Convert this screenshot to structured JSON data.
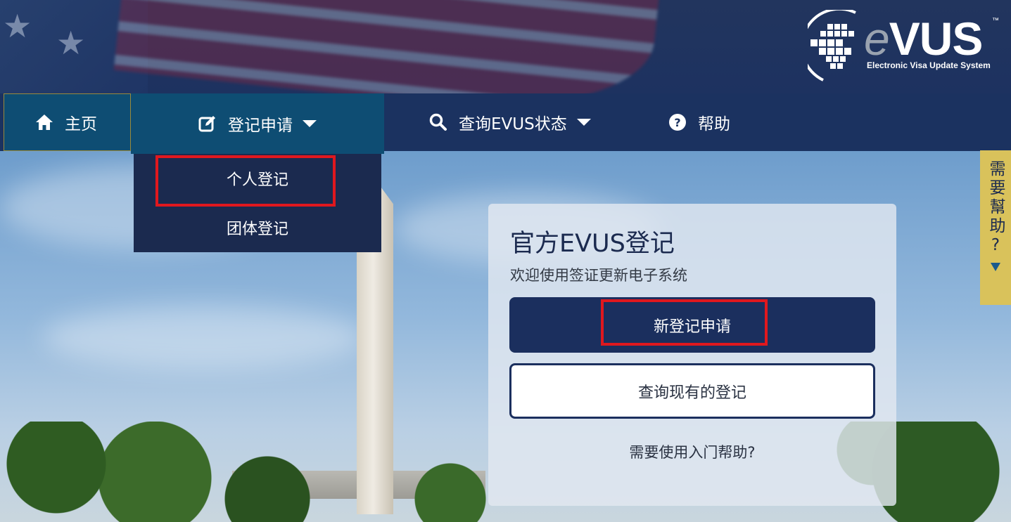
{
  "header": {
    "logo": {
      "word_e": "e",
      "word_vus": "VUS",
      "tm": "™",
      "subtitle": "Electronic Visa Update System"
    }
  },
  "nav": {
    "home_label": "主页",
    "register_label": "登记申请",
    "check_label": "查询EVUS状态",
    "help_label": "帮助",
    "icons": {
      "home": "home-icon",
      "register": "edit-icon",
      "check": "search-icon",
      "help": "question-circle-icon"
    }
  },
  "dropdown": {
    "items": [
      {
        "label": "个人登记"
      },
      {
        "label": "团体登记"
      }
    ]
  },
  "card": {
    "title": "官方EVUS登记",
    "subtitle": "欢迎使用签证更新电子系统",
    "new_button": "新登记申请",
    "check_button": "查询现有的登记",
    "help_link": "需要使用入门帮助?"
  },
  "help_tab": {
    "label": "需要幫助?"
  },
  "colors": {
    "navy": "#1b2f5e",
    "nav_active": "#0e4d73",
    "highlight": "#e0181e",
    "help_tab": "#d9c25b"
  }
}
